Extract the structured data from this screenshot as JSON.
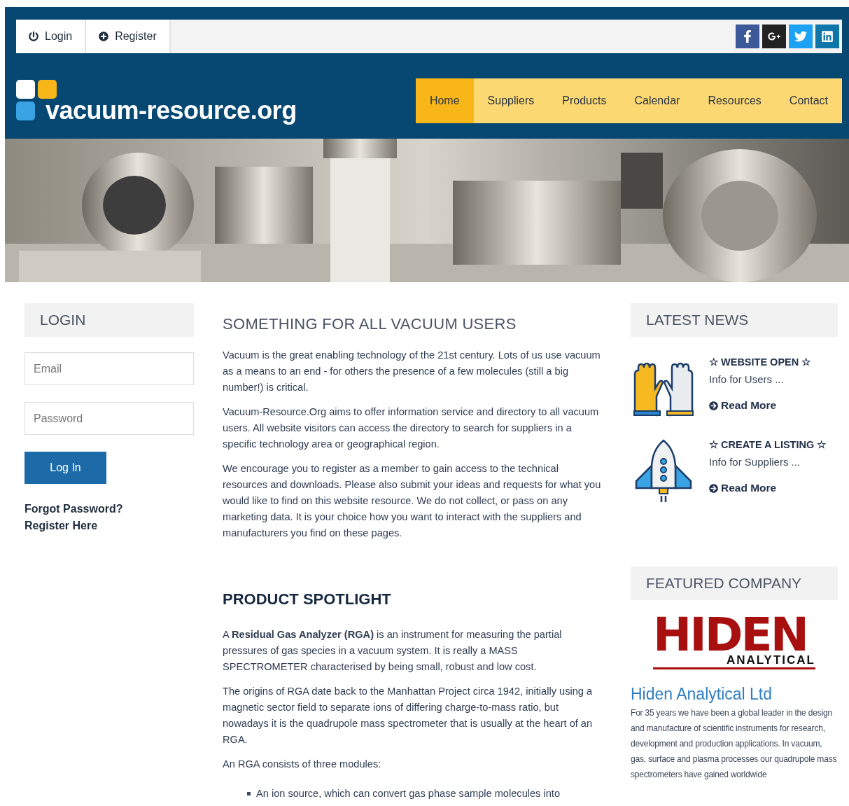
{
  "top_bar": {
    "links": [
      {
        "label": "Login"
      },
      {
        "label": "Register"
      }
    ]
  },
  "header": {
    "logo_text": "vacuum-resource.org",
    "nav": [
      {
        "label": "Home",
        "selected": true
      },
      {
        "label": "Suppliers",
        "selected": false
      },
      {
        "label": "Products",
        "selected": false
      },
      {
        "label": "Calendar",
        "selected": false
      },
      {
        "label": "Resources",
        "selected": false
      },
      {
        "label": "Contact",
        "selected": false
      }
    ]
  },
  "login": {
    "title": "LOGIN",
    "email_placeholder": "Email",
    "password_placeholder": "Password",
    "button": "Log In",
    "links": [
      "Forgot Password?",
      "Register Here"
    ]
  },
  "intro": {
    "title": "SOMETHING FOR ALL VACUUM USERS",
    "paragraphs": [
      "Vacuum is the great enabling technology of the 21st century.  Lots of us use vacuum as a means to an end - for others the presence of a few molecules (still a big number!) is critical.",
      "Vacuum-Resource.Org aims to offer information service and directory to all vacuum users.  All website visitors can access the directory to search for suppliers in a specific technology area or geographical region.",
      "We encourage you to register as a member to gain access to the technical resources and downloads.  Please also submit your ideas and requests for what you would like to find on this website resource.  We do not collect, or pass on any marketing data.   It is your choice how you want to interact with the suppliers and manufacturers you find on these pages."
    ]
  },
  "spotlight": {
    "title": "PRODUCT SPOTLIGHT",
    "paragraphs": [
      "A **Residual Gas Analyzer (RGA)** is an instrument for measuring the partial pressures of gas species in a vacuum system.   It is really a MASS SPECTROMETER characterised by being small, robust and low cost.",
      "The origins of RGA date back to the Manhattan Project circa 1942, initially using a magnetic sector field to separate ions of differing charge-to-mass ratio, but nowadays it is the quadrupole mass spectrometer that is usually at the heart of an RGA.",
      "An RGA consists of three modules:"
    ],
    "bullets": [
      "An ion source, which can convert gas phase sample molecules into"
    ]
  },
  "news": {
    "title": "LATEST NEWS",
    "items": [
      {
        "kind": "gloves",
        "star": "☆",
        "headline": "WEBSITE OPEN",
        "summary": "Info for Users ...",
        "link": "Read More"
      },
      {
        "kind": "rocket",
        "star": "☆",
        "headline": "CREATE A LISTING",
        "summary": "Info for Suppliers ...",
        "link": "Read More"
      }
    ]
  },
  "featured": {
    "title": "FEATURED COMPANY",
    "logo_word": "HIDEN",
    "logo_sub": "ANALYTICAL",
    "name": "Hiden Analytical Ltd",
    "description": "For 35 years we have been a global leader in the design and manufacture of scientific instruments for research, development and production applications. In vacuum, gas, surface and plasma processes our quadrupole mass spectrometers have gained worldwide"
  }
}
